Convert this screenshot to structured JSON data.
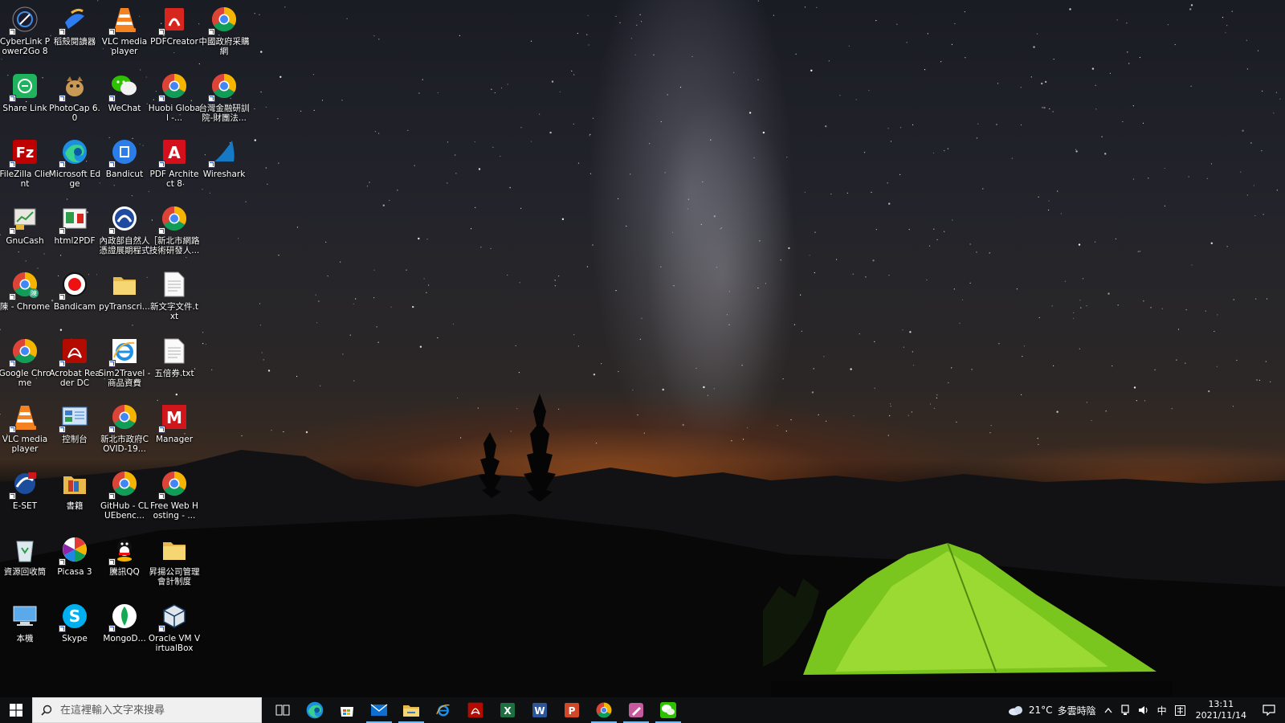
{
  "desktop": {
    "icons": [
      {
        "label": "CyberLink Power2Go 8",
        "icon": "power2go-icon"
      },
      {
        "label": "稻殼閱讀器",
        "icon": "docer-reader-icon"
      },
      {
        "label": "VLC media player",
        "icon": "vlc-icon"
      },
      {
        "label": "PDFCreator",
        "icon": "pdfcreator-icon"
      },
      {
        "label": "中國政府采購網",
        "icon": "chrome-icon"
      },
      {
        "label": "Share Link",
        "icon": "share-link-icon"
      },
      {
        "label": "PhotoCap 6.0",
        "icon": "photocap-icon"
      },
      {
        "label": "WeChat",
        "icon": "wechat-icon"
      },
      {
        "label": "Huobi Global -...",
        "icon": "chrome-icon"
      },
      {
        "label": "台灣金融研訓院-財團法...",
        "icon": "chrome-icon"
      },
      {
        "label": "FileZilla Client",
        "icon": "filezilla-icon"
      },
      {
        "label": "Microsoft Edge",
        "icon": "edge-icon"
      },
      {
        "label": "Bandicut",
        "icon": "bandicut-icon"
      },
      {
        "label": "PDF Architect 8",
        "icon": "pdf-architect-icon"
      },
      {
        "label": "Wireshark",
        "icon": "wireshark-icon"
      },
      {
        "label": "GnuCash",
        "icon": "gnucash-icon"
      },
      {
        "label": "html2PDF",
        "icon": "html2pdf-icon"
      },
      {
        "label": "內政部自然人憑證展期程式",
        "icon": "moica-icon"
      },
      {
        "label": "［新北市網路技術研發人...",
        "icon": "chrome-icon"
      },
      {
        "label": "陳 - Chrome",
        "icon": "chrome-profile-icon"
      },
      {
        "label": "Bandicam",
        "icon": "bandicam-icon"
      },
      {
        "label": "pyTranscri...",
        "icon": "folder-icon"
      },
      {
        "label": "新文字文件.txt",
        "icon": "text-file-icon"
      },
      {
        "label": "Google Chrome",
        "icon": "chrome-icon"
      },
      {
        "label": "Acrobat Reader DC",
        "icon": "acrobat-icon"
      },
      {
        "label": "Sim2Travel - 商品資費",
        "icon": "ie-icon"
      },
      {
        "label": "五倍券.txt",
        "icon": "text-file-icon"
      },
      {
        "label": "VLC media player",
        "icon": "vlc-icon"
      },
      {
        "label": "控制台",
        "icon": "control-panel-icon"
      },
      {
        "label": "新北市政府COVID-19...",
        "icon": "chrome-icon"
      },
      {
        "label": "Manager",
        "icon": "manager-icon"
      },
      {
        "label": "E-SET",
        "icon": "eset-icon"
      },
      {
        "label": "書籍",
        "icon": "books-folder-icon"
      },
      {
        "label": "GitHub - CLUEbenc...",
        "icon": "chrome-icon"
      },
      {
        "label": "Free Web Hosting - ...",
        "icon": "chrome-icon"
      },
      {
        "label": "資源回收筒",
        "icon": "recycle-bin-icon"
      },
      {
        "label": "Picasa 3",
        "icon": "picasa-icon"
      },
      {
        "label": "騰訊QQ",
        "icon": "qq-icon"
      },
      {
        "label": "昇揚公司管理會計制度",
        "icon": "folder-icon"
      },
      {
        "label": "本機",
        "icon": "this-pc-icon"
      },
      {
        "label": "Skype",
        "icon": "skype-icon"
      },
      {
        "label": "MongoD...",
        "icon": "mongodb-icon"
      },
      {
        "label": "Oracle VM VirtualBox",
        "icon": "virtualbox-icon"
      }
    ]
  },
  "taskbar": {
    "search_placeholder": "在這裡輸入文字來搜尋",
    "pinned": [
      {
        "icon": "task-view-icon",
        "active": false
      },
      {
        "icon": "edge-icon",
        "active": false
      },
      {
        "icon": "store-icon",
        "active": false
      },
      {
        "icon": "mail-icon",
        "active": true
      },
      {
        "icon": "file-explorer-icon",
        "active": true
      },
      {
        "icon": "ie-icon",
        "active": false
      },
      {
        "icon": "acrobat-icon",
        "active": false
      },
      {
        "icon": "excel-icon",
        "active": false
      },
      {
        "icon": "word-icon",
        "active": false
      },
      {
        "icon": "powerpoint-icon",
        "active": false
      },
      {
        "icon": "chrome-icon",
        "active": true
      },
      {
        "icon": "pen-app-icon",
        "active": true
      },
      {
        "icon": "wechat-icon",
        "active": true
      }
    ],
    "tray": {
      "weather_temp": "21°C",
      "weather_text": "多雲時陰",
      "ime": "中",
      "time": "13:11",
      "date": "2021/11/14"
    }
  }
}
